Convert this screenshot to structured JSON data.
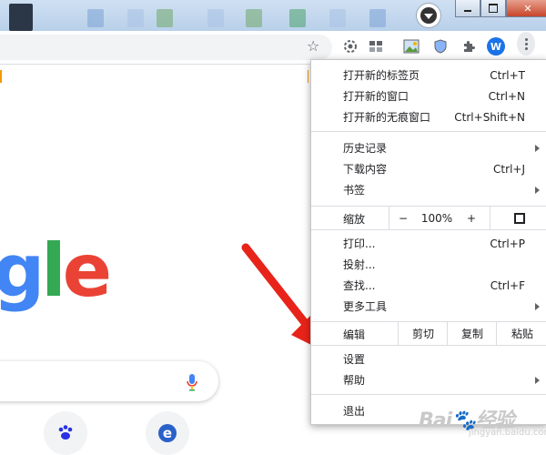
{
  "toolbar": {
    "profile_initial": "W"
  },
  "logo": {
    "text": "gle"
  },
  "menu": {
    "items": [
      {
        "label": "打开新的标签页",
        "shortcut": "Ctrl+T"
      },
      {
        "label": "打开新的窗口",
        "shortcut": "Ctrl+N"
      },
      {
        "label": "打开新的无痕窗口",
        "shortcut": "Ctrl+Shift+N"
      },
      {
        "label": "历史记录",
        "shortcut": ""
      },
      {
        "label": "下载内容",
        "shortcut": "Ctrl+J"
      },
      {
        "label": "书签",
        "shortcut": ""
      },
      {
        "label": "打印...",
        "shortcut": "Ctrl+P"
      },
      {
        "label": "投射...",
        "shortcut": ""
      },
      {
        "label": "查找...",
        "shortcut": "Ctrl+F"
      },
      {
        "label": "更多工具",
        "shortcut": ""
      },
      {
        "label": "设置",
        "shortcut": ""
      },
      {
        "label": "帮助",
        "shortcut": ""
      },
      {
        "label": "退出",
        "shortcut": ""
      }
    ],
    "zoom": {
      "label": "缩放",
      "minus": "−",
      "value": "100%",
      "plus": "+"
    },
    "edit": {
      "label": "编辑",
      "cut": "剪切",
      "copy": "复制",
      "paste": "粘贴"
    }
  },
  "watermark": {
    "brand": "Bai",
    "suffix": "经验",
    "sub": "jingyan.baidu.com"
  },
  "colors": {
    "arrow": "#e8231a",
    "accent": "#1a73e8"
  }
}
